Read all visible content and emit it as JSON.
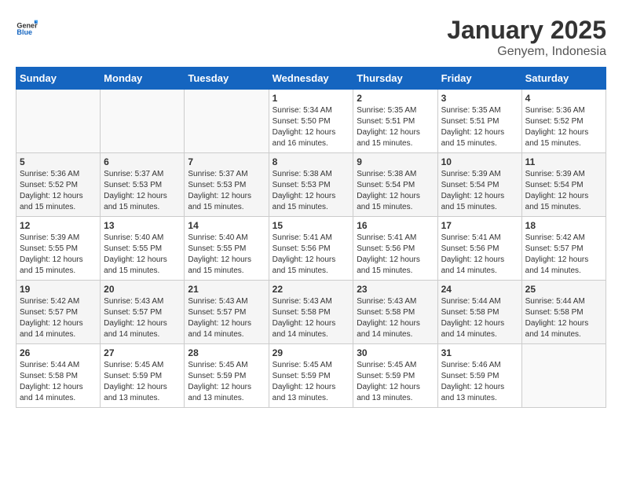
{
  "logo": {
    "general": "General",
    "blue": "Blue"
  },
  "header": {
    "month": "January 2025",
    "location": "Genyem, Indonesia"
  },
  "weekdays": [
    "Sunday",
    "Monday",
    "Tuesday",
    "Wednesday",
    "Thursday",
    "Friday",
    "Saturday"
  ],
  "weeks": [
    [
      {
        "day": "",
        "info": ""
      },
      {
        "day": "",
        "info": ""
      },
      {
        "day": "",
        "info": ""
      },
      {
        "day": "1",
        "info": "Sunrise: 5:34 AM\nSunset: 5:50 PM\nDaylight: 12 hours\nand 16 minutes."
      },
      {
        "day": "2",
        "info": "Sunrise: 5:35 AM\nSunset: 5:51 PM\nDaylight: 12 hours\nand 15 minutes."
      },
      {
        "day": "3",
        "info": "Sunrise: 5:35 AM\nSunset: 5:51 PM\nDaylight: 12 hours\nand 15 minutes."
      },
      {
        "day": "4",
        "info": "Sunrise: 5:36 AM\nSunset: 5:52 PM\nDaylight: 12 hours\nand 15 minutes."
      }
    ],
    [
      {
        "day": "5",
        "info": "Sunrise: 5:36 AM\nSunset: 5:52 PM\nDaylight: 12 hours\nand 15 minutes."
      },
      {
        "day": "6",
        "info": "Sunrise: 5:37 AM\nSunset: 5:53 PM\nDaylight: 12 hours\nand 15 minutes."
      },
      {
        "day": "7",
        "info": "Sunrise: 5:37 AM\nSunset: 5:53 PM\nDaylight: 12 hours\nand 15 minutes."
      },
      {
        "day": "8",
        "info": "Sunrise: 5:38 AM\nSunset: 5:53 PM\nDaylight: 12 hours\nand 15 minutes."
      },
      {
        "day": "9",
        "info": "Sunrise: 5:38 AM\nSunset: 5:54 PM\nDaylight: 12 hours\nand 15 minutes."
      },
      {
        "day": "10",
        "info": "Sunrise: 5:39 AM\nSunset: 5:54 PM\nDaylight: 12 hours\nand 15 minutes."
      },
      {
        "day": "11",
        "info": "Sunrise: 5:39 AM\nSunset: 5:54 PM\nDaylight: 12 hours\nand 15 minutes."
      }
    ],
    [
      {
        "day": "12",
        "info": "Sunrise: 5:39 AM\nSunset: 5:55 PM\nDaylight: 12 hours\nand 15 minutes."
      },
      {
        "day": "13",
        "info": "Sunrise: 5:40 AM\nSunset: 5:55 PM\nDaylight: 12 hours\nand 15 minutes."
      },
      {
        "day": "14",
        "info": "Sunrise: 5:40 AM\nSunset: 5:55 PM\nDaylight: 12 hours\nand 15 minutes."
      },
      {
        "day": "15",
        "info": "Sunrise: 5:41 AM\nSunset: 5:56 PM\nDaylight: 12 hours\nand 15 minutes."
      },
      {
        "day": "16",
        "info": "Sunrise: 5:41 AM\nSunset: 5:56 PM\nDaylight: 12 hours\nand 15 minutes."
      },
      {
        "day": "17",
        "info": "Sunrise: 5:41 AM\nSunset: 5:56 PM\nDaylight: 12 hours\nand 14 minutes."
      },
      {
        "day": "18",
        "info": "Sunrise: 5:42 AM\nSunset: 5:57 PM\nDaylight: 12 hours\nand 14 minutes."
      }
    ],
    [
      {
        "day": "19",
        "info": "Sunrise: 5:42 AM\nSunset: 5:57 PM\nDaylight: 12 hours\nand 14 minutes."
      },
      {
        "day": "20",
        "info": "Sunrise: 5:43 AM\nSunset: 5:57 PM\nDaylight: 12 hours\nand 14 minutes."
      },
      {
        "day": "21",
        "info": "Sunrise: 5:43 AM\nSunset: 5:57 PM\nDaylight: 12 hours\nand 14 minutes."
      },
      {
        "day": "22",
        "info": "Sunrise: 5:43 AM\nSunset: 5:58 PM\nDaylight: 12 hours\nand 14 minutes."
      },
      {
        "day": "23",
        "info": "Sunrise: 5:43 AM\nSunset: 5:58 PM\nDaylight: 12 hours\nand 14 minutes."
      },
      {
        "day": "24",
        "info": "Sunrise: 5:44 AM\nSunset: 5:58 PM\nDaylight: 12 hours\nand 14 minutes."
      },
      {
        "day": "25",
        "info": "Sunrise: 5:44 AM\nSunset: 5:58 PM\nDaylight: 12 hours\nand 14 minutes."
      }
    ],
    [
      {
        "day": "26",
        "info": "Sunrise: 5:44 AM\nSunset: 5:58 PM\nDaylight: 12 hours\nand 14 minutes."
      },
      {
        "day": "27",
        "info": "Sunrise: 5:45 AM\nSunset: 5:59 PM\nDaylight: 12 hours\nand 13 minutes."
      },
      {
        "day": "28",
        "info": "Sunrise: 5:45 AM\nSunset: 5:59 PM\nDaylight: 12 hours\nand 13 minutes."
      },
      {
        "day": "29",
        "info": "Sunrise: 5:45 AM\nSunset: 5:59 PM\nDaylight: 12 hours\nand 13 minutes."
      },
      {
        "day": "30",
        "info": "Sunrise: 5:45 AM\nSunset: 5:59 PM\nDaylight: 12 hours\nand 13 minutes."
      },
      {
        "day": "31",
        "info": "Sunrise: 5:46 AM\nSunset: 5:59 PM\nDaylight: 12 hours\nand 13 minutes."
      },
      {
        "day": "",
        "info": ""
      }
    ]
  ]
}
